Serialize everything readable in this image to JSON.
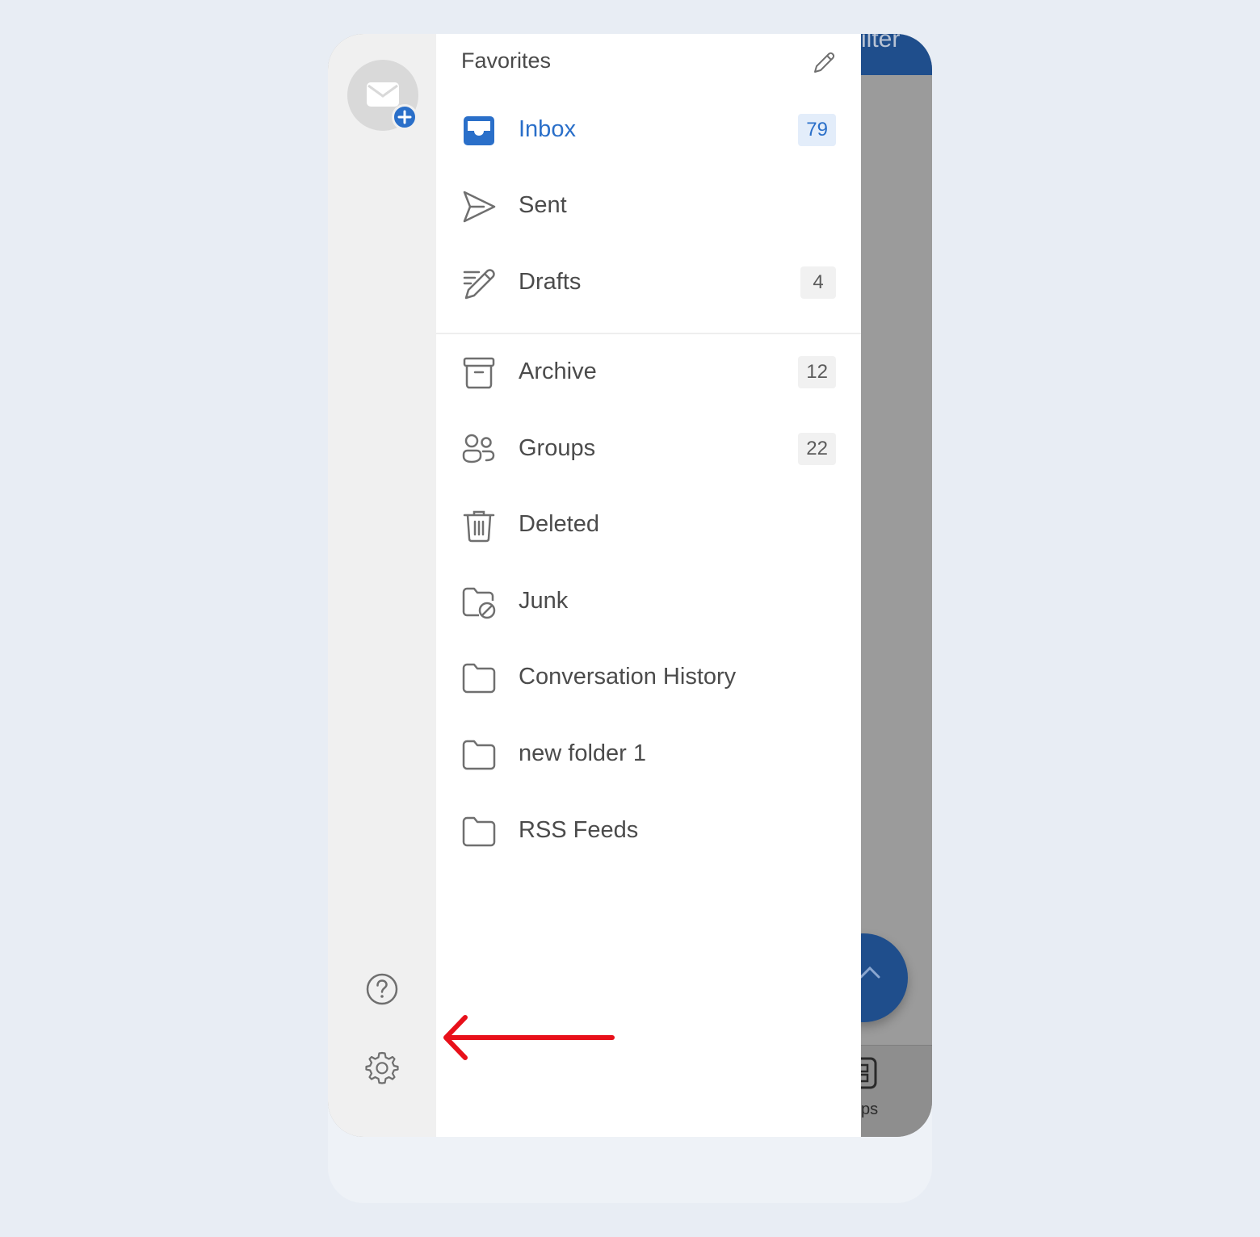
{
  "colors": {
    "accent": "#2a6fc9",
    "annotation_arrow": "#e8101a",
    "background_overlay": "#9b9b9b"
  },
  "background_app": {
    "header_fragment": "ilter",
    "tab_fragment": "ps"
  },
  "rail": {
    "account_icon": "mail-plus-icon",
    "help_icon": "help-circle-icon",
    "settings_icon": "gear-icon"
  },
  "favorites": {
    "title": "Favorites",
    "edit_icon": "pencil-icon",
    "items": [
      {
        "label": "Inbox",
        "count": "79",
        "icon": "inbox-icon",
        "active": true
      },
      {
        "label": "Sent",
        "count": "",
        "icon": "send-icon"
      },
      {
        "label": "Drafts",
        "count": "4",
        "icon": "drafts-icon"
      }
    ]
  },
  "folders": {
    "items": [
      {
        "label": "Archive",
        "count": "12",
        "icon": "archive-icon"
      },
      {
        "label": "Groups",
        "count": "22",
        "icon": "groups-icon"
      },
      {
        "label": "Deleted",
        "count": "",
        "icon": "trash-icon"
      },
      {
        "label": "Junk",
        "count": "",
        "icon": "junk-folder-icon"
      },
      {
        "label": "Conversation History",
        "count": "",
        "icon": "folder-icon"
      },
      {
        "label": "new folder 1",
        "count": "",
        "icon": "folder-icon"
      },
      {
        "label": "RSS Feeds",
        "count": "",
        "icon": "folder-icon"
      }
    ]
  },
  "annotation": {
    "arrow_icon": "left-arrow-icon",
    "points_to": "settings"
  }
}
